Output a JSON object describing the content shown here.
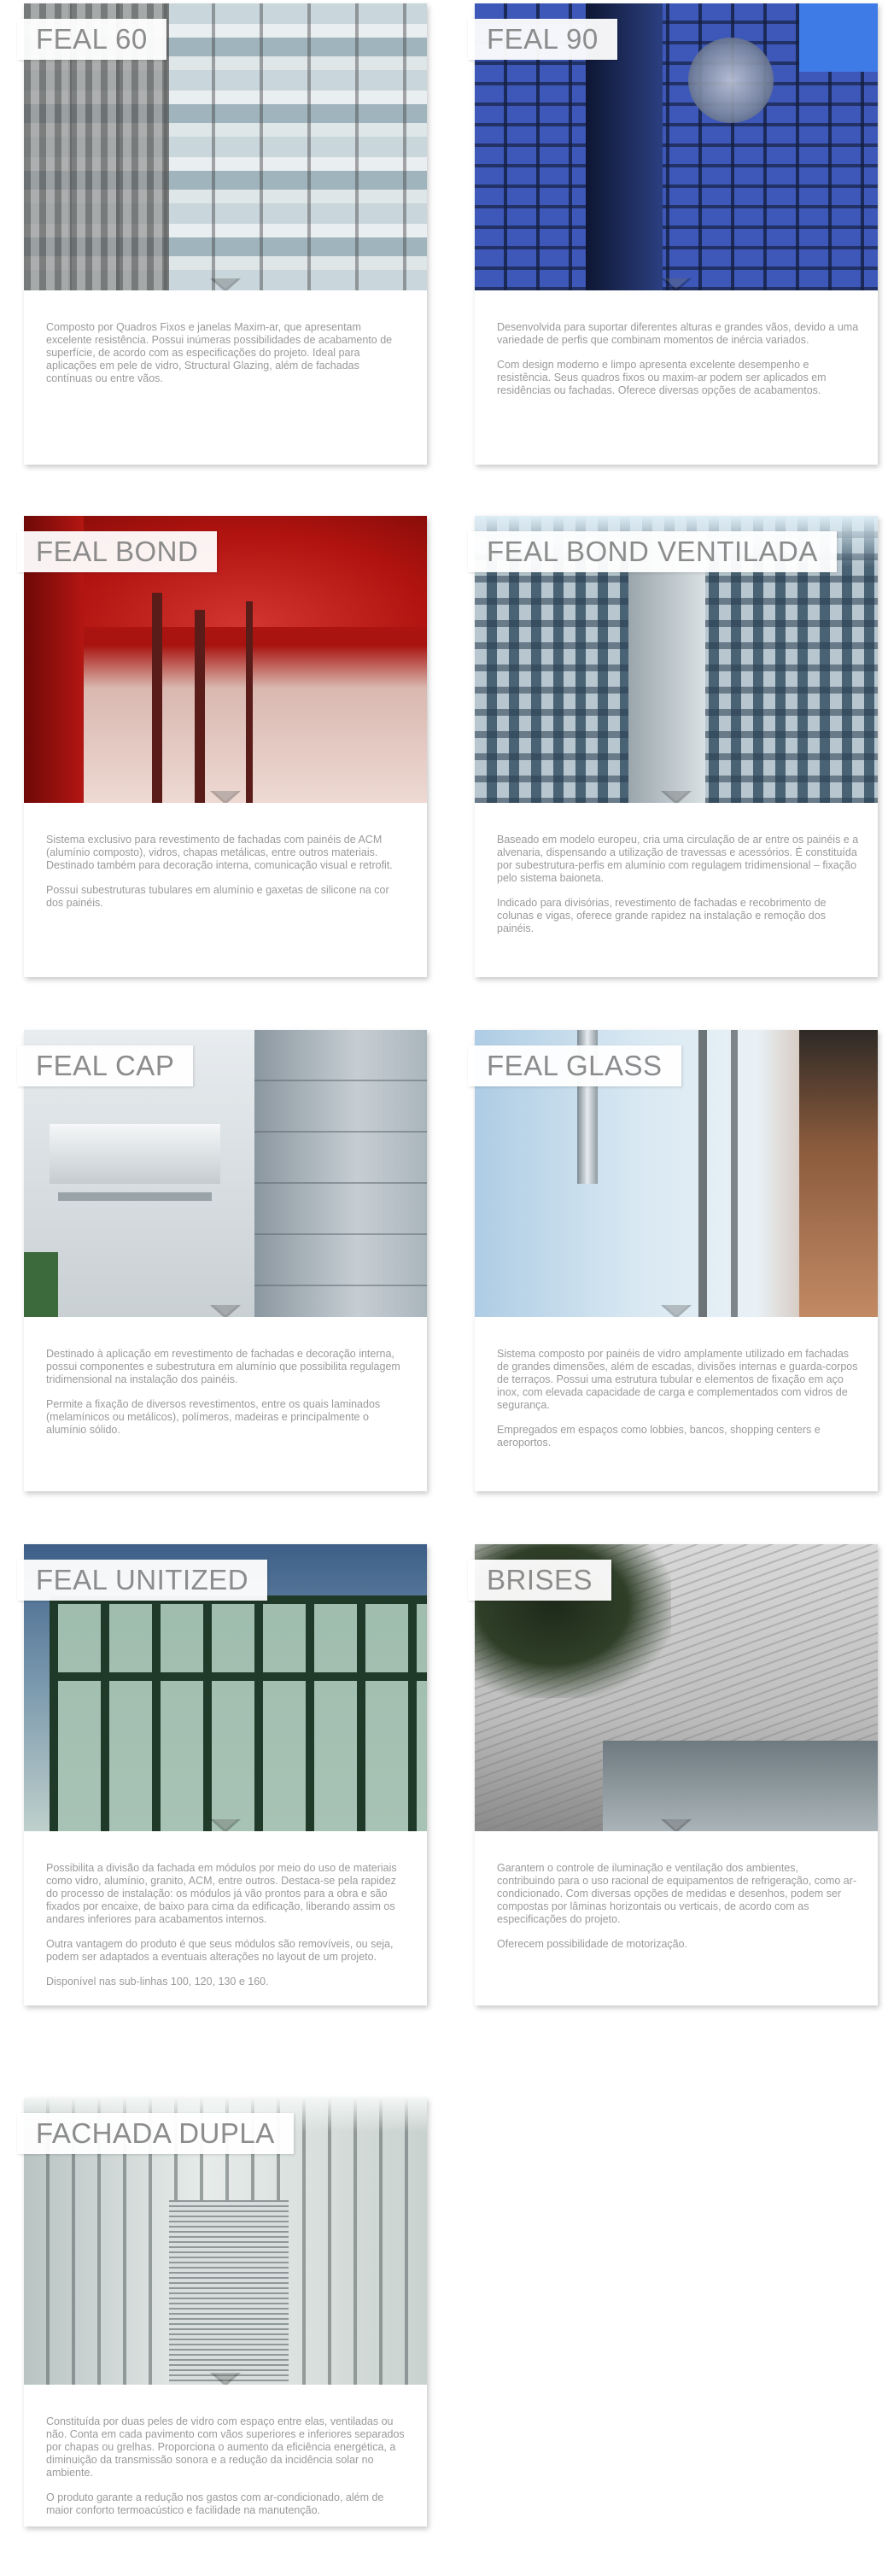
{
  "cards": [
    {
      "title": "FEAL 60",
      "paragraphs": [
        "Composto por Quadros Fixos e janelas Maxim-ar, que apresentam excelente resistência. Possui inúmeras possibilidades de acabamento de superfície, de acordo com as especificações do projeto. Ideal para aplicações em pele de vidro, Structural Glazing, além de fachadas contínuas ou entre vãos."
      ]
    },
    {
      "title": "FEAL 90",
      "paragraphs": [
        "Desenvolvida para suportar diferentes alturas e grandes vãos, devido a uma variedade de perfis que combinam momentos de inércia variados.",
        "Com design moderno e limpo apresenta excelente desempenho e resistência. Seus quadros fixos ou maxim-ar podem ser aplicados em residências ou fachadas. Oferece diversas opções de acabamentos."
      ]
    },
    {
      "title": "FEAL BOND",
      "paragraphs": [
        "Sistema exclusivo para revestimento de fachadas com painéis de ACM (alumínio composto), vidros, chapas metálicas, entre outros materiais. Destinado também para decoração interna, comunicação visual e retrofit.",
        "Possui subestruturas tubulares em alumínio e gaxetas de silicone na cor dos painéis."
      ]
    },
    {
      "title": "FEAL BOND VENTILADA",
      "paragraphs": [
        "Baseado em modelo europeu, cria uma circulação de ar entre os painéis e a alvenaria, dispensando a utilização de travessas e acessórios. É constituída por subestrutura-perfis em alumínio com regulagem tridimensional – fixação pelo sistema baioneta.",
        "Indicado para divisórias, revestimento de fachadas e recobrimento de colunas e vigas, oferece grande rapidez na instalação e remoção dos painéis."
      ]
    },
    {
      "title": "FEAL CAP",
      "paragraphs": [
        "Destinado à aplicação em revestimento de fachadas e decoração interna, possui componentes e subestrutura em alumínio que possibilita regulagem tridimensional na instalação dos painéis.",
        "Permite a fixação de diversos revestimentos, entre os quais laminados (melamínicos ou metálicos), polímeros, madeiras e principalmente o alumínio sólido."
      ]
    },
    {
      "title": "FEAL GLASS",
      "paragraphs": [
        "Sistema composto por painéis de vidro amplamente utilizado em fachadas de grandes dimensões, além de escadas, divisões internas e guarda-corpos de terraços. Possui uma estrutura tubular e elementos de fixação em aço inox, com elevada capacidade de carga e complementados com vidros de segurança.",
        "Empregados em espaços como lobbies, bancos, shopping centers e aeroportos."
      ]
    },
    {
      "title": "FEAL UNITIZED",
      "paragraphs": [
        "Possibilita a divisão da fachada em módulos por meio do uso de materiais como vidro, alumínio, granito, ACM, entre outros. Destaca-se pela rapidez do processo de instalação: os módulos já vão prontos para a obra e são fixados por encaixe, de baixo para cima da edificação, liberando assim os andares inferiores para acabamentos internos.",
        "Outra vantagem do produto é que seus módulos são removíveis, ou seja, podem ser adaptados a eventuais alterações no layout de um projeto.",
        "Disponível nas sub-linhas 100, 120, 130 e 160."
      ]
    },
    {
      "title": "BRISES",
      "paragraphs": [
        "Garantem o controle de iluminação e ventilação dos ambientes, contribuindo para o uso racional de equipamentos de refrigeração, como ar-condicionado. Com diversas opções de medidas e desenhos, podem ser compostas por lâminas horizontais ou verticais, de acordo com as especificações do projeto.",
        "Oferecem possibilidade de motorização."
      ]
    },
    {
      "title": "FACHADA DUPLA",
      "paragraphs": [
        "Constituída por duas peles de vidro com espaço entre elas, ventiladas ou não. Conta em cada pavimento com vãos superiores e inferiores separados por chapas ou grelhas. Proporciona o aumento da eficiência energética, a diminuição da transmissão sonora e a redução da incidência solar no ambiente.",
        "O produto garante a redução nos gastos com ar-condicionado, além de maior conforto termoacústico e facilidade na manutenção."
      ]
    }
  ]
}
